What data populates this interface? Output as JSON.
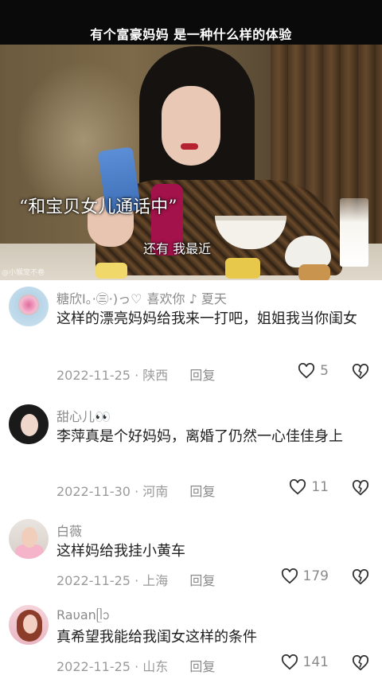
{
  "video": {
    "title": "有个富豪妈妈 是一种什么样的体验",
    "subtitle": "“和宝贝女儿通话中”",
    "subtitle_line2": "还有 我最近",
    "watermark": "@小猴宠不卷"
  },
  "comments": [
    {
      "username": "糖欣I。·㊂·)っ♡",
      "username_extra": "喜欢你 ♪ 夏天",
      "text": "这样的漂亮妈妈给我来一打吧，姐姐我当你闺女",
      "date": "2022-11-25",
      "location": "陕西",
      "reply_label": "回复",
      "likes": "5"
    },
    {
      "username": "甜心儿👀",
      "username_extra": "",
      "text": "李萍真是个好妈妈，离婚了仍然一心佳佳身上",
      "date": "2022-11-30",
      "location": "河南",
      "reply_label": "回复",
      "likes": "11"
    },
    {
      "username": "白薇",
      "username_extra": "",
      "text": "这样妈给我挂小黄车",
      "date": "2022-11-25",
      "location": "上海",
      "reply_label": "回复",
      "likes": "179"
    },
    {
      "username": "Raυanᥫᩣ",
      "username_extra": "",
      "text": "真希望我能给我闺女这样的条件",
      "date": "2022-11-25",
      "location": "山东",
      "reply_label": "回复",
      "likes": "141"
    }
  ],
  "icons": {
    "like": "heart-outline-icon",
    "dislike": "broken-heart-icon"
  },
  "colors": {
    "text": "#1e1e1e",
    "meta": "#9a9a9a",
    "background": "#ffffff"
  }
}
